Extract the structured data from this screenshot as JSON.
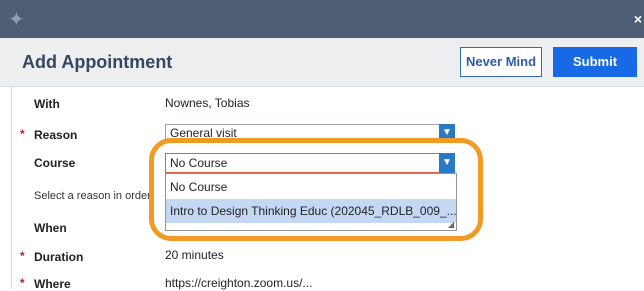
{
  "app": {
    "logo_icon": "star-logo-icon",
    "close_icon": "close-icon"
  },
  "header": {
    "title": "Add Appointment",
    "never_mind_label": "Never Mind",
    "submit_label": "Submit"
  },
  "form": {
    "with": {
      "label": "With",
      "value": "Nownes, Tobias"
    },
    "reason": {
      "label": "Reason",
      "required": "*",
      "value": "General visit"
    },
    "course": {
      "label": "Course",
      "value": "No Course",
      "options": [
        "No Course",
        "Intro to Design Thinking Educ (202045_RDLB_009_..."
      ]
    },
    "hint": "Select a reason in order",
    "when": {
      "label": "When"
    },
    "duration": {
      "label": "Duration",
      "required": "*",
      "value": "20 minutes"
    },
    "where": {
      "label": "Where",
      "required": "*",
      "value": "https://creighton.zoom.us/..."
    }
  },
  "colors": {
    "topbar": "#4d5d73",
    "primary": "#1769e6",
    "highlight": "#f19a26",
    "required": "#b8232a"
  }
}
